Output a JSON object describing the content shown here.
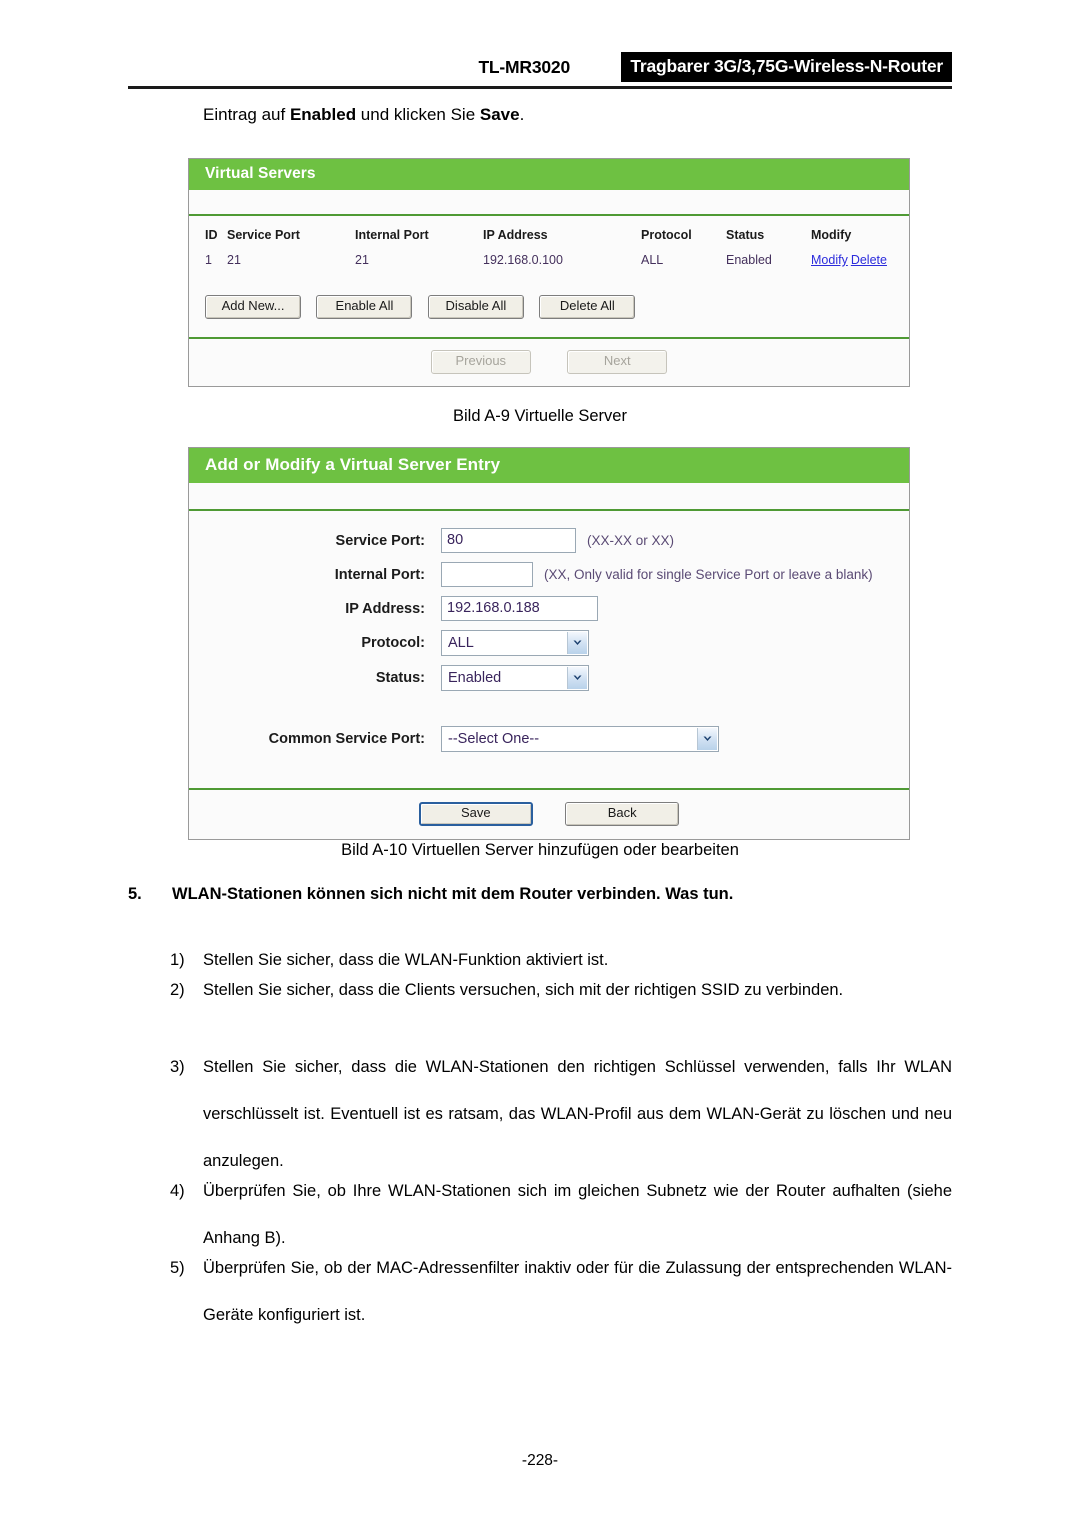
{
  "header": {
    "model": "TL-MR3020",
    "product_badge": "Tragbarer 3G/3,75G-Wireless-N-Router"
  },
  "intro": {
    "before": "Eintrag auf ",
    "bold1": "Enabled",
    "middle": " und klicken Sie ",
    "bold2": "Save",
    "after": "."
  },
  "virtual_servers_panel": {
    "title": "Virtual Servers",
    "columns": [
      "ID",
      "Service Port",
      "Internal Port",
      "IP Address",
      "Protocol",
      "Status",
      "Modify"
    ],
    "rows": [
      {
        "id": "1",
        "service_port": "21",
        "internal_port": "21",
        "ip_address": "192.168.0.100",
        "protocol": "ALL",
        "status": "Enabled",
        "modify_link": "Modify",
        "delete_link": "Delete"
      }
    ],
    "buttons": {
      "add_new": "Add New...",
      "enable_all": "Enable All",
      "disable_all": "Disable All",
      "delete_all": "Delete All"
    },
    "pager": {
      "previous": "Previous",
      "next": "Next"
    }
  },
  "caption_a9": "Bild A-9 Virtuelle Server",
  "add_modify_panel": {
    "title": "Add or Modify a Virtual Server Entry",
    "fields": {
      "service_port": {
        "label": "Service Port:",
        "value": "80",
        "hint": "(XX-XX or XX)"
      },
      "internal_port": {
        "label": "Internal Port:",
        "value": "",
        "hint": "(XX, Only valid for single Service Port or leave a blank)"
      },
      "ip_address": {
        "label": "IP Address:",
        "value": "192.168.0.188",
        "hint": ""
      },
      "protocol": {
        "label": "Protocol:",
        "value": "ALL"
      },
      "status": {
        "label": "Status:",
        "value": "Enabled"
      },
      "common_service_port": {
        "label": "Common Service Port:",
        "value": "--Select One--"
      }
    },
    "buttons": {
      "save": "Save",
      "back": "Back"
    }
  },
  "caption_a10": "Bild A-10 Virtuellen Server hinzufügen oder bearbeiten",
  "section": {
    "number": "5.",
    "heading": "WLAN-Stationen können sich nicht mit dem Router verbinden. Was tun.",
    "items": [
      {
        "marker": "1)",
        "text": "Stellen Sie sicher, dass die WLAN-Funktion aktiviert ist."
      },
      {
        "marker": "2)",
        "text": "Stellen Sie sicher, dass die Clients versuchen, sich mit der richtigen SSID zu verbinden."
      },
      {
        "marker": "3)",
        "text": "Stellen Sie sicher, dass die WLAN-Stationen den richtigen Schlüssel verwenden, falls Ihr WLAN verschlüsselt ist. Eventuell ist es ratsam, das WLAN-Profil aus dem WLAN-Gerät zu löschen und neu anzulegen."
      },
      {
        "marker": "4)",
        "text": "Überprüfen Sie, ob Ihre WLAN-Stationen sich im gleichen Subnetz wie der Router aufhalten (siehe Anhang B)."
      },
      {
        "marker": "5)",
        "text": "Überprüfen Sie, ob der MAC-Adressenfilter inaktiv oder für die Zulassung der entsprechenden WLAN-Geräte konfiguriert ist."
      }
    ]
  },
  "page_number": "-228-",
  "colors": {
    "panel_green": "#6ec142",
    "panel_rule_green": "#4f9a34",
    "link_blue": "#2b2bdc",
    "badge_black": "#000000"
  }
}
